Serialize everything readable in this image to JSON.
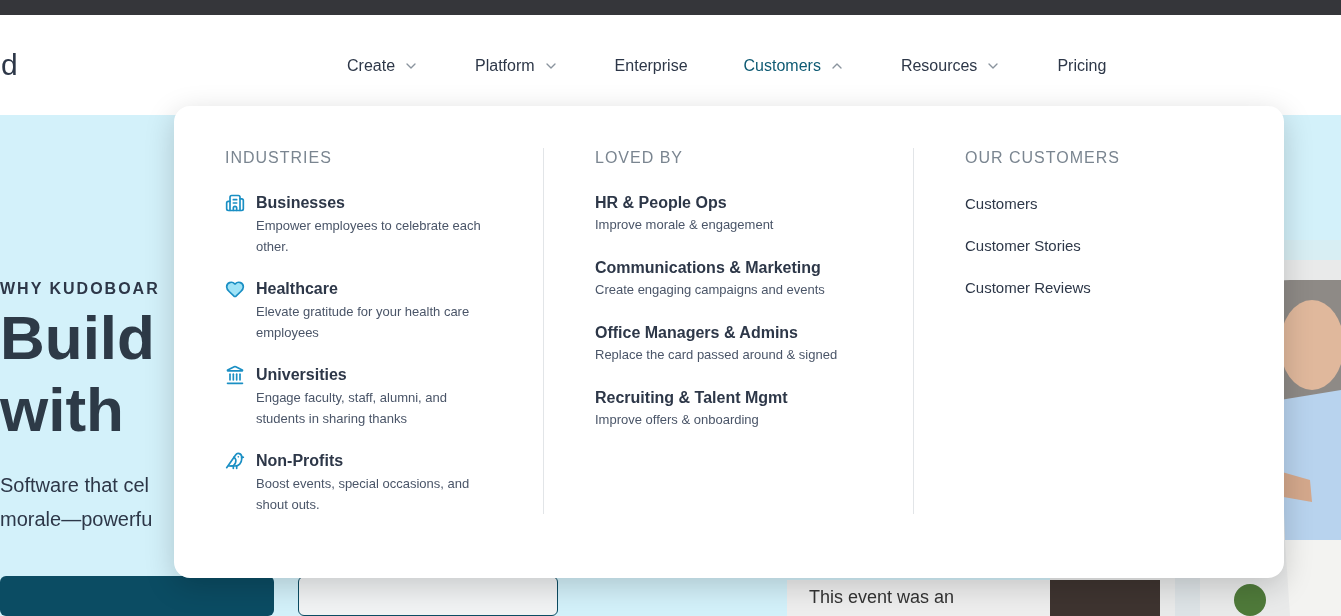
{
  "header": {
    "logo_fragment": "d",
    "nav": [
      {
        "label": "Create",
        "kind": "menu",
        "expanded": false,
        "selected": false
      },
      {
        "label": "Platform",
        "kind": "menu",
        "expanded": false,
        "selected": false
      },
      {
        "label": "Enterprise",
        "kind": "link",
        "selected": false
      },
      {
        "label": "Customers",
        "kind": "menu",
        "expanded": true,
        "selected": true
      },
      {
        "label": "Resources",
        "kind": "menu",
        "expanded": false,
        "selected": false
      },
      {
        "label": "Pricing",
        "kind": "link",
        "selected": false
      }
    ]
  },
  "hero": {
    "eyebrow": "WHY KUDOBOAR",
    "headline_lines": [
      "Build",
      "with"
    ],
    "subtitle_lines": [
      "Software that cel",
      "morale—powerfu"
    ],
    "testimonial_snippet": "This event was an",
    "photo": {
      "kind": "picture"
    }
  },
  "dropdown": {
    "industries": {
      "heading": "INDUSTRIES",
      "items": [
        {
          "kind": "building",
          "title": "Businesses",
          "description": "Empower employees to celebrate each other."
        },
        {
          "kind": "heart",
          "title": "Healthcare",
          "description": "Elevate gratitude for your health care employees"
        },
        {
          "kind": "landmark",
          "title": "Universities",
          "description": "Engage faculty, staff, alumni, and students in sharing thanks"
        },
        {
          "kind": "bird",
          "title": "Non-Profits",
          "description": "Boost events, special occasions, and shout outs."
        }
      ]
    },
    "loved_by": {
      "heading": "LOVED BY",
      "items": [
        {
          "title": "HR & People Ops",
          "description": "Improve morale & engagement"
        },
        {
          "title": "Communications & Marketing",
          "description": "Create engaging campaigns and events"
        },
        {
          "title": "Office Managers & Admins",
          "description": "Replace the card passed around & signed"
        },
        {
          "title": "Recruiting & Talent Mgmt",
          "description": "Improve offers & onboarding"
        }
      ]
    },
    "our_customers": {
      "heading": "OUR CUSTOMERS",
      "links": [
        "Customers",
        "Customer Stories",
        "Customer Reviews"
      ]
    }
  }
}
